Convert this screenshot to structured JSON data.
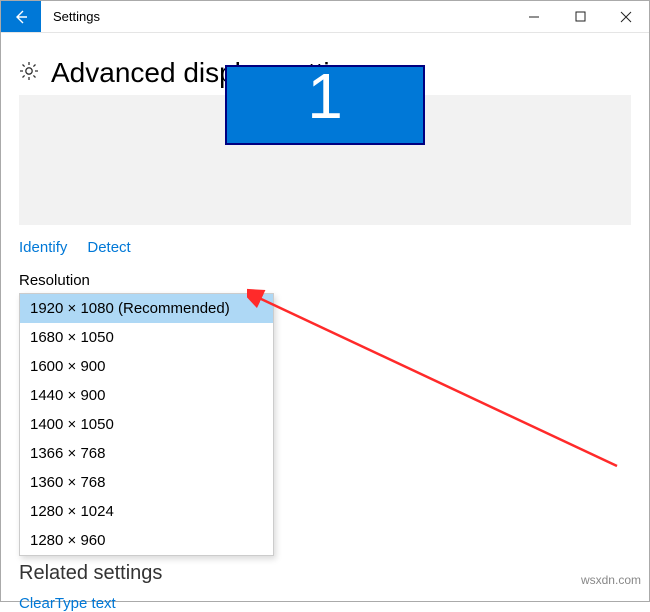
{
  "window": {
    "title": "Settings"
  },
  "page": {
    "heading": "Advanced display settings",
    "monitor_number": "1",
    "identify": "Identify",
    "detect": "Detect",
    "resolution_label": "Resolution",
    "related_heading": "Related settings",
    "cleartype_link": "ClearType text"
  },
  "resolution_options": [
    "1920 × 1080 (Recommended)",
    "1680 × 1050",
    "1600 × 900",
    "1440 × 900",
    "1400 × 1050",
    "1366 × 768",
    "1360 × 768",
    "1280 × 1024",
    "1280 × 960"
  ],
  "selected_index": 0,
  "watermark": "wsxdn.com"
}
